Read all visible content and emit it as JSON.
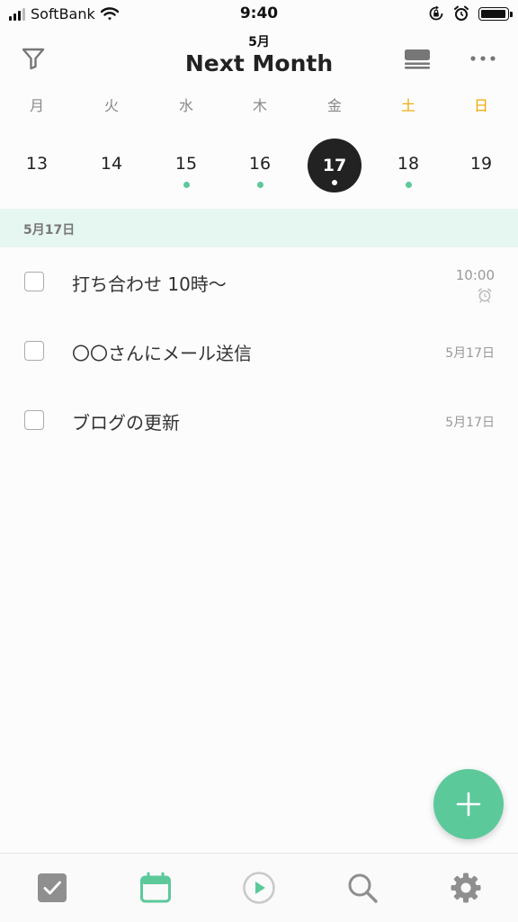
{
  "status_bar": {
    "carrier": "SoftBank",
    "time": "9:40",
    "battery_level": 0.95
  },
  "header": {
    "month": "5月",
    "title": "Next Month",
    "icons": [
      "filter-icon",
      "list-view-icon",
      "more-icon"
    ]
  },
  "weekdays": [
    "月",
    "火",
    "水",
    "木",
    "金",
    "土",
    "日"
  ],
  "dates": [
    {
      "day": "13",
      "has_tasks": false,
      "selected": false
    },
    {
      "day": "14",
      "has_tasks": false,
      "selected": false
    },
    {
      "day": "15",
      "has_tasks": true,
      "selected": false
    },
    {
      "day": "16",
      "has_tasks": true,
      "selected": false
    },
    {
      "day": "17",
      "has_tasks": true,
      "selected": true
    },
    {
      "day": "18",
      "has_tasks": true,
      "selected": false
    },
    {
      "day": "19",
      "has_tasks": false,
      "selected": false
    }
  ],
  "section": {
    "label": "5月17日"
  },
  "tasks": [
    {
      "title": "打ち合わせ 10時〜",
      "meta": "10:00",
      "alarm": true,
      "checked": false
    },
    {
      "title": "〇〇さんにメール送信",
      "meta": "5月17日",
      "alarm": false,
      "checked": false
    },
    {
      "title": "ブログの更新",
      "meta": "5月17日",
      "alarm": false,
      "checked": false
    }
  ],
  "fab": {
    "icon": "plus-icon"
  },
  "tab_bar": {
    "tabs": [
      {
        "icon": "checkbox-icon",
        "active": false
      },
      {
        "icon": "calendar-icon",
        "active": true
      },
      {
        "icon": "play-icon",
        "active": false
      },
      {
        "icon": "search-icon",
        "active": false
      },
      {
        "icon": "gear-icon",
        "active": false
      }
    ]
  },
  "colors": {
    "accent": "#5cc99b",
    "weekend": "#f0a800",
    "section_bg": "#e6f6f0",
    "selected_date": "#222222"
  }
}
